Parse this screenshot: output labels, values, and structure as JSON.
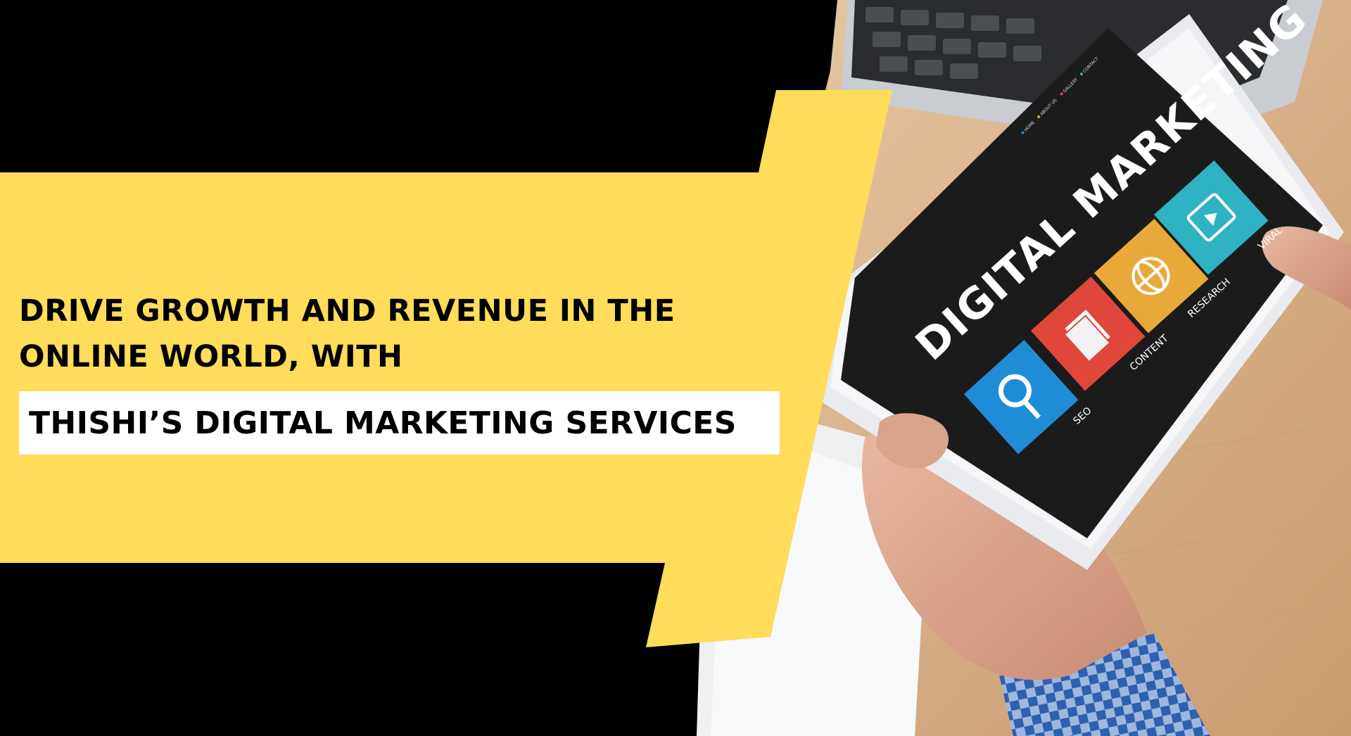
{
  "headline": {
    "line1": "DRIVE GROWTH AND REVENUE IN THE",
    "line2": "ONLINE WORLD, WITH"
  },
  "highlight": {
    "text": "THISHI’S DIGITAL MARKETING SERVICES"
  },
  "tablet": {
    "title": "DIGITAL MARKETING",
    "nav": [
      "HOME",
      "ABOUT US",
      "GALLERY",
      "CONTACT"
    ],
    "tiles": [
      {
        "label": "SEO",
        "color": "#1f8dd6",
        "icon": "magnifier-icon"
      },
      {
        "label": "CONTENT",
        "color": "#e0473a",
        "icon": "documents-icon"
      },
      {
        "label": "RESEARCH",
        "color": "#e9a93a",
        "icon": "globe-icon"
      },
      {
        "label": "VIRAL",
        "color": "#2fb2c2",
        "icon": "video-tablet-icon"
      }
    ]
  },
  "colors": {
    "banner_yellow": "#ffdc5a",
    "background_black": "#000000",
    "screen_dark": "#1b1b1b",
    "desk_wood": "#d9b48c"
  }
}
